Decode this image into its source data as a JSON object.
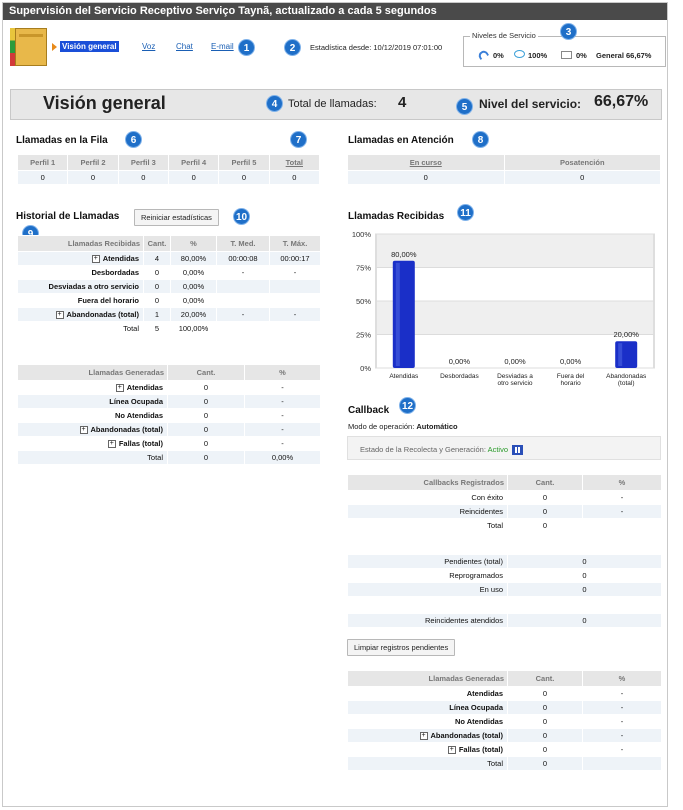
{
  "window": {
    "title": "Supervisión del Servicio Receptivo Serviço Taynã, actualizado a cada 5 segundos"
  },
  "nav": {
    "active": "Visión general",
    "voz": "Voz",
    "chat": "Chat",
    "email": "E-mail"
  },
  "stats_since": "Estadística desde: 10/12/2019 07:01:00",
  "service_levels": {
    "legend": "Niveles de Servicio",
    "voice": "0%",
    "chat": "100%",
    "email": "0%",
    "general": "General 66,67%"
  },
  "badges": [
    "1",
    "2",
    "3",
    "4",
    "5",
    "6",
    "7",
    "8",
    "9",
    "10",
    "11",
    "12"
  ],
  "overview": {
    "title": "Visión general",
    "total_label": "Total de llamadas:",
    "total_value": "4",
    "level_label": "Nivel del servicio:",
    "level_value": "66,67%"
  },
  "queue": {
    "title": "Llamadas en la Fila",
    "headers": [
      "Perfil 1",
      "Perfil 2",
      "Perfil 3",
      "Perfil 4",
      "Perfil 5",
      "Total"
    ],
    "values": [
      "0",
      "0",
      "0",
      "0",
      "0",
      "0"
    ]
  },
  "attention": {
    "title": "Llamadas en Atención",
    "headers": [
      "En curso",
      "Posatención"
    ],
    "values": [
      "0",
      "0"
    ]
  },
  "history": {
    "title": "Historial de Llamadas",
    "reset_button": "Reiniciar estadísticas",
    "received_headers": [
      "Llamadas Recibidas",
      "Cant.",
      "%",
      "T. Med.",
      "T. Máx."
    ],
    "received_rows": [
      [
        "Atendidas",
        "4",
        "80,00%",
        "00:00:08",
        "00:00:17"
      ],
      [
        "Desbordadas",
        "0",
        "0,00%",
        "-",
        "-"
      ],
      [
        "Desviadas a otro servicio",
        "0",
        "0,00%",
        "",
        ""
      ],
      [
        "Fuera del horario",
        "0",
        "0,00%",
        "",
        ""
      ],
      [
        "Abandonadas (total)",
        "1",
        "20,00%",
        "-",
        "-"
      ],
      [
        "Total",
        "5",
        "100,00%",
        "",
        ""
      ]
    ],
    "generated_headers": [
      "Llamadas Generadas",
      "Cant.",
      "%"
    ],
    "generated_rows": [
      [
        "Atendidas",
        "0",
        "-"
      ],
      [
        "Línea Ocupada",
        "0",
        "-"
      ],
      [
        "No Atendidas",
        "0",
        "-"
      ],
      [
        "Abandonadas (total)",
        "0",
        "-"
      ],
      [
        "Fallas (total)",
        "0",
        "-"
      ],
      [
        "Total",
        "0",
        "0,00%"
      ]
    ]
  },
  "received_chart_title": "Llamadas Recibidas",
  "chart_data": {
    "type": "bar",
    "categories": [
      "Atendidas",
      "Desbordadas",
      "Desviadas a otro servicio",
      "Fuera del horario",
      "Abandonadas (total)"
    ],
    "category_lines": [
      [
        "Atendidas"
      ],
      [
        "Desbordadas"
      ],
      [
        "Desviadas a",
        "otro servicio"
      ],
      [
        "Fuera del",
        "horario"
      ],
      [
        "Abandonadas",
        "(total)"
      ]
    ],
    "values": [
      80,
      0,
      0,
      0,
      20
    ],
    "data_labels": [
      "80,00%",
      "0,00%",
      "0,00%",
      "0,00%",
      "20,00%"
    ],
    "ylim": [
      0,
      100
    ],
    "yticks": [
      "0%",
      "25%",
      "50%",
      "75%",
      "100%"
    ],
    "bar_color": "#1a2fc8"
  },
  "callback": {
    "title": "Callback",
    "mode_label": "Modo de operación:",
    "mode_value": "Automático",
    "status_label": "Estado de la Recolecta y Generación:",
    "status_value": "Activo",
    "registered_headers": [
      "Callbacks Registrados",
      "Cant.",
      "%"
    ],
    "registered_rows": [
      [
        "Con éxito",
        "0",
        "-"
      ],
      [
        "Reincidentes",
        "0",
        "-"
      ],
      [
        "Total",
        "0",
        ""
      ]
    ],
    "pending_rows": [
      [
        "Pendientes (total)",
        "0"
      ],
      [
        "Reprogramados",
        "0"
      ],
      [
        "En uso",
        "0"
      ]
    ],
    "attended_row": [
      "Reincidentes atendidos",
      "0"
    ],
    "clear_button": "Limpiar registros pendientes",
    "generated_headers": [
      "Llamadas Generadas",
      "Cant.",
      "%"
    ],
    "generated_rows": [
      [
        "Atendidas",
        "0",
        "-"
      ],
      [
        "Línea Ocupada",
        "0",
        "-"
      ],
      [
        "No Atendidas",
        "0",
        "-"
      ],
      [
        "Abandonadas (total)",
        "0",
        "-"
      ],
      [
        "Fallas (total)",
        "0",
        "-"
      ],
      [
        "Total",
        "0",
        ""
      ]
    ]
  }
}
